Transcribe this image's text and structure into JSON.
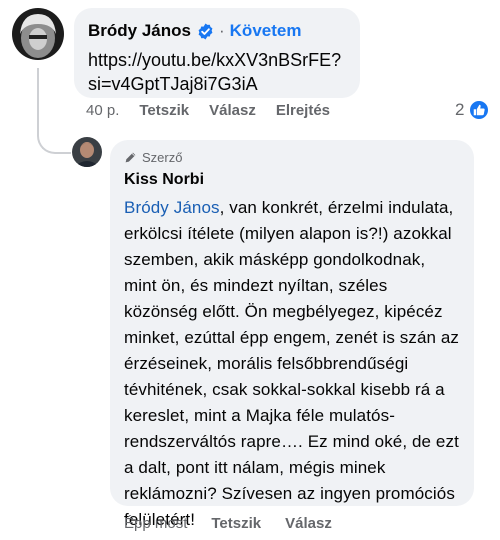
{
  "comment1": {
    "author": "Bródy János",
    "separator": "·",
    "follow_label": "Követem",
    "text": "https://youtu.be/kxXV3nBSrFE?si=v4GptTJaj8i7G3iA",
    "time": "40 p.",
    "actions": {
      "like": "Tetszik",
      "reply": "Válasz",
      "hide": "Elrejtés"
    },
    "reaction_count": "2",
    "reaction_icon": "like-icon",
    "badge_icon": "verified-badge-icon",
    "accent_color": "#1877f2"
  },
  "comment2": {
    "badge": "Szerző",
    "badge_icon": "pencil-icon",
    "author": "Kiss Norbi",
    "mention": "Bródy János",
    "text": ", van konkrét, érzelmi indulata, erkölcsi ítélete (milyen alapon is?!) azokkal szemben, akik másképp gondolkodnak, mint ön, és mindezt nyíltan, széles közönség előtt. Ön megbélyegez, kipécéz minket, ezúttal épp engem, zenét is szán az érzéseinek, morális felsőbbrendűségi tévhitének, csak sokkal-sokkal kisebb rá a kereslet, mint a Majka féle mulatós-rendszerváltós rapre…. Ez mind oké, de ezt a dalt, pont itt nálam, mégis minek reklámozni? Szívesen az ingyen promóciós felületért!",
    "time": "Épp most",
    "actions": {
      "like": "Tetszik",
      "reply": "Válasz"
    }
  }
}
